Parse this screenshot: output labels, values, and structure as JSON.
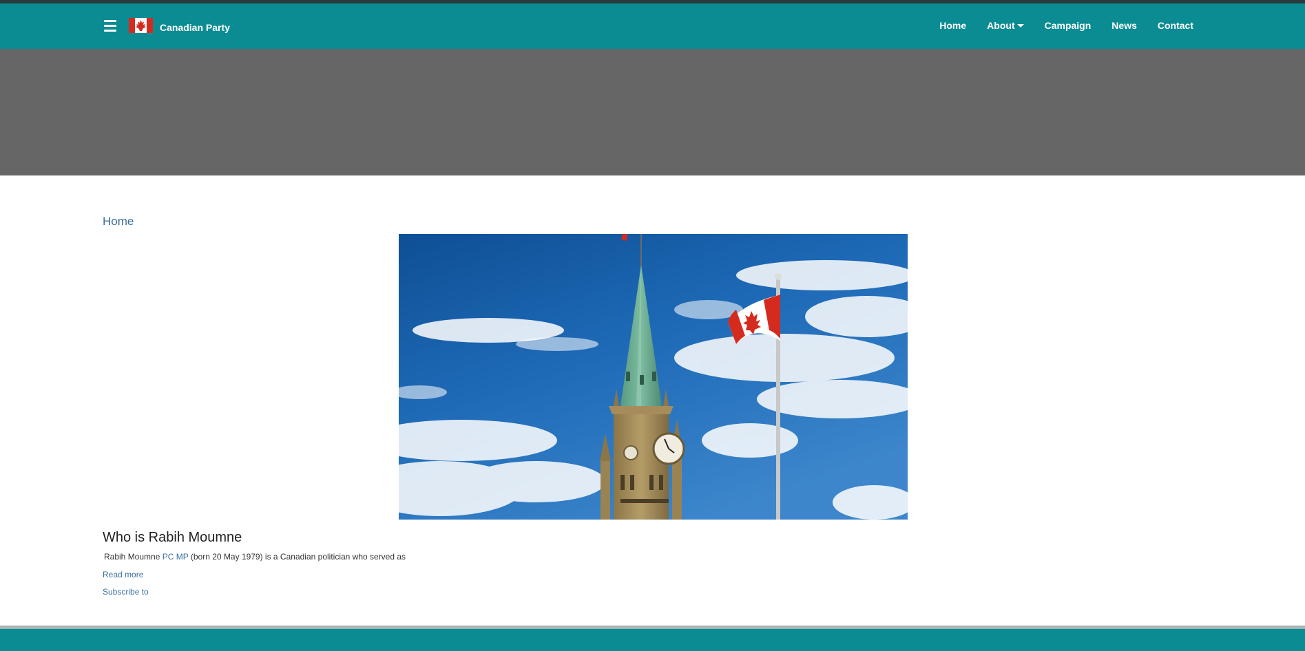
{
  "header": {
    "brand": "Canadian Party",
    "nav": {
      "home": "Home",
      "about": "About",
      "campaign": "Campaign",
      "news": "News",
      "contact": "Contact"
    }
  },
  "breadcrumb": "Home",
  "article": {
    "title": "Who is Rabih Moumne",
    "teaser_prefix": "Rabih Moumne ",
    "link_pc": "PC",
    "link_mp": "MP",
    "teaser_suffix": " (born 20 May 1979) is a Canadian politician who served as",
    "read_more": "Read more",
    "subscribe": "Subscribe to"
  },
  "colors": {
    "navbar": "#0b8b92",
    "banner": "#666666",
    "link": "#3a6f9e"
  },
  "icons": {
    "menu": "hamburger-icon",
    "logo": "canadian-flag-icon",
    "dropdown": "caret-down-icon"
  }
}
